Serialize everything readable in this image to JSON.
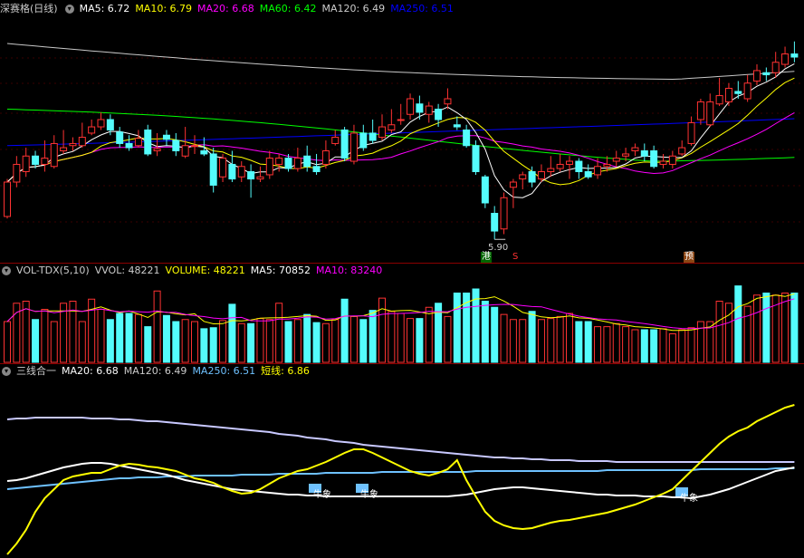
{
  "main_header": {
    "title": "深赛格(日线)",
    "items": [
      {
        "label": "MA5:",
        "value": "6.72",
        "color": "#ffffff"
      },
      {
        "label": "MA10:",
        "value": "6.79",
        "color": "#ffff00"
      },
      {
        "label": "MA20:",
        "value": "6.68",
        "color": "#ff00ff"
      },
      {
        "label": "MA60:",
        "value": "6.42",
        "color": "#00ff00"
      },
      {
        "label": "MA120:",
        "value": "6.49",
        "color": "#cccccc"
      },
      {
        "label": "MA250:",
        "value": "6.51",
        "color": "#0000ff"
      }
    ]
  },
  "vol_header": {
    "items": [
      {
        "label": "VOL-TDX(5,10)",
        "value": "",
        "color": "#cccccc"
      },
      {
        "label": "VVOL:",
        "value": "48221",
        "color": "#cccccc"
      },
      {
        "label": "VOLUME:",
        "value": "48221",
        "color": "#ffff00"
      },
      {
        "label": "MA5:",
        "value": "70852",
        "color": "#ffffff"
      },
      {
        "label": "MA10:",
        "value": "83240",
        "color": "#ff00ff"
      }
    ]
  },
  "ind_header": {
    "items": [
      {
        "label": "三线合一",
        "value": "",
        "color": "#cccccc"
      },
      {
        "label": "MA20:",
        "value": "6.68",
        "color": "#ffffff"
      },
      {
        "label": "MA120:",
        "value": "6.49",
        "color": "#cccccc"
      },
      {
        "label": "MA250:",
        "value": "6.51",
        "color": "#6ec1ff"
      },
      {
        "label": "短线:",
        "value": "6.86",
        "color": "#ffff00"
      }
    ]
  },
  "low_label": "5.90",
  "markers": {
    "gang": "港",
    "s": "S",
    "yu": "预"
  },
  "signal_label": "牛象",
  "colors": {
    "up": "#ff3232",
    "down": "#54fcfc",
    "ma5": "#ffffff",
    "ma10": "#ffff00",
    "ma20": "#ff00ff",
    "ma60": "#00ff00",
    "ma120": "#c8c8c8",
    "ma250": "#0000ff"
  },
  "chart_data": {
    "type": "candlestick",
    "candles": [
      [
        6.12,
        6.45,
        6.48,
        6.1
      ],
      [
        6.45,
        6.62,
        6.7,
        6.4
      ],
      [
        6.55,
        6.7,
        6.78,
        6.5
      ],
      [
        6.7,
        6.62,
        6.75,
        6.58
      ],
      [
        6.62,
        6.68,
        6.85,
        6.55
      ],
      [
        6.6,
        6.82,
        6.9,
        6.58
      ],
      [
        6.75,
        6.78,
        6.95,
        6.72
      ],
      [
        6.8,
        6.82,
        6.88,
        6.75
      ],
      [
        6.8,
        6.88,
        7.02,
        6.78
      ],
      [
        6.92,
        6.98,
        7.05,
        6.9
      ],
      [
        6.98,
        7.05,
        7.12,
        6.95
      ],
      [
        7.05,
        6.95,
        7.1,
        6.9
      ],
      [
        6.93,
        6.82,
        6.98,
        6.78
      ],
      [
        6.82,
        6.78,
        6.9,
        6.75
      ],
      [
        6.8,
        6.87,
        6.95,
        6.78
      ],
      [
        6.95,
        6.72,
        7.0,
        6.7
      ],
      [
        6.75,
        6.77,
        6.92,
        6.7
      ],
      [
        6.9,
        6.86,
        6.95,
        6.8
      ],
      [
        6.85,
        6.75,
        6.92,
        6.7
      ],
      [
        6.7,
        6.8,
        6.98,
        6.68
      ],
      [
        6.8,
        6.8,
        6.9,
        6.72
      ],
      [
        6.75,
        6.72,
        6.88,
        6.7
      ],
      [
        6.72,
        6.42,
        6.78,
        6.35
      ],
      [
        6.5,
        6.68,
        6.72,
        6.45
      ],
      [
        6.62,
        6.48,
        6.75,
        6.45
      ],
      [
        6.5,
        6.6,
        6.65,
        6.45
      ],
      [
        6.55,
        6.48,
        6.62,
        6.3
      ],
      [
        6.48,
        6.5,
        6.6,
        6.45
      ],
      [
        6.52,
        6.68,
        6.75,
        6.48
      ],
      [
        6.62,
        6.68,
        6.72,
        6.55
      ],
      [
        6.68,
        6.58,
        6.72,
        6.55
      ],
      [
        6.58,
        6.68,
        6.78,
        6.55
      ],
      [
        6.7,
        6.6,
        6.8,
        6.55
      ],
      [
        6.6,
        6.55,
        6.72,
        6.52
      ],
      [
        6.62,
        6.75,
        6.85,
        6.58
      ],
      [
        6.82,
        6.88,
        6.95,
        6.8
      ],
      [
        6.95,
        6.68,
        6.98,
        6.65
      ],
      [
        6.65,
        6.92,
        7.0,
        6.62
      ],
      [
        6.92,
        6.78,
        7.0,
        6.75
      ],
      [
        6.92,
        6.85,
        7.05,
        6.82
      ],
      [
        6.88,
        6.98,
        7.1,
        6.85
      ],
      [
        6.95,
        7.0,
        7.15,
        6.92
      ],
      [
        7.05,
        7.05,
        7.2,
        7.0
      ],
      [
        7.1,
        7.25,
        7.3,
        7.05
      ],
      [
        7.2,
        7.12,
        7.28,
        7.05
      ],
      [
        7.1,
        7.18,
        7.22,
        7.02
      ],
      [
        7.15,
        7.05,
        7.2,
        6.98
      ],
      [
        7.2,
        7.25,
        7.35,
        7.15
      ],
      [
        7.0,
        6.98,
        7.08,
        6.95
      ],
      [
        6.95,
        6.8,
        7.0,
        6.78
      ],
      [
        6.8,
        6.55,
        6.85,
        6.52
      ],
      [
        6.5,
        6.25,
        6.52,
        6.2
      ],
      [
        6.15,
        5.98,
        6.22,
        5.9
      ],
      [
        6.0,
        6.3,
        6.35,
        5.95
      ],
      [
        6.4,
        6.45,
        6.48,
        6.2
      ],
      [
        6.48,
        6.52,
        6.55,
        6.38
      ],
      [
        6.55,
        6.45,
        6.6,
        6.4
      ],
      [
        6.48,
        6.55,
        6.62,
        6.45
      ],
      [
        6.55,
        6.58,
        6.7,
        6.5
      ],
      [
        6.58,
        6.62,
        6.72,
        6.55
      ],
      [
        6.62,
        6.65,
        6.7,
        6.48
      ],
      [
        6.65,
        6.55,
        6.68,
        6.48
      ],
      [
        6.55,
        6.5,
        6.62,
        6.48
      ],
      [
        6.52,
        6.6,
        6.68,
        6.48
      ],
      [
        6.6,
        6.62,
        6.7,
        6.55
      ],
      [
        6.65,
        6.68,
        6.75,
        6.6
      ],
      [
        6.7,
        6.72,
        6.78,
        6.65
      ],
      [
        6.75,
        6.78,
        6.82,
        6.7
      ],
      [
        6.75,
        6.7,
        6.82,
        6.65
      ],
      [
        6.75,
        6.6,
        6.8,
        6.58
      ],
      [
        6.62,
        6.65,
        6.72,
        6.58
      ],
      [
        6.62,
        6.7,
        6.75,
        6.58
      ],
      [
        6.72,
        6.78,
        6.85,
        6.7
      ],
      [
        6.82,
        7.02,
        7.08,
        6.8
      ],
      [
        7.05,
        7.22,
        7.25,
        7.0
      ],
      [
        7.0,
        7.22,
        7.3,
        6.98
      ],
      [
        7.2,
        7.28,
        7.45,
        7.18
      ],
      [
        7.22,
        7.35,
        7.4,
        7.18
      ],
      [
        7.32,
        7.3,
        7.42,
        7.25
      ],
      [
        7.25,
        7.4,
        7.48,
        7.22
      ],
      [
        7.42,
        7.52,
        7.58,
        7.38
      ],
      [
        7.5,
        7.48,
        7.55,
        7.42
      ],
      [
        7.5,
        7.6,
        7.7,
        7.45
      ],
      [
        7.58,
        7.68,
        7.75,
        7.55
      ],
      [
        7.68,
        7.65,
        7.8,
        7.6
      ]
    ],
    "volume": [
      40,
      58,
      60,
      42,
      52,
      40,
      58,
      60,
      40,
      62,
      52,
      42,
      48,
      48,
      47,
      35,
      70,
      46,
      40,
      42,
      40,
      33,
      34,
      41,
      57,
      38,
      38,
      43,
      42,
      58,
      40,
      42,
      47,
      39,
      38,
      42,
      62,
      45,
      42,
      51,
      63,
      50,
      48,
      43,
      43,
      54,
      58,
      45,
      68,
      68,
      72,
      60,
      54,
      47,
      42,
      42,
      50,
      42,
      43,
      45,
      48,
      40,
      40,
      35,
      35,
      38,
      35,
      32,
      32,
      32,
      33,
      28,
      32,
      34,
      40,
      40,
      60,
      58,
      75,
      55,
      66,
      68,
      66,
      68,
      68
    ],
    "ind_series": {
      "ma20": [
        531,
        530,
        528,
        525,
        522,
        519,
        516,
        514,
        512,
        511,
        511,
        512,
        514,
        516,
        518,
        520,
        522,
        524,
        527,
        530,
        532,
        534,
        536,
        538,
        540,
        541,
        542,
        543,
        544,
        545,
        546,
        546,
        547,
        547,
        548,
        548,
        548,
        548,
        548,
        548,
        548,
        548,
        548,
        548,
        548,
        548,
        548,
        548,
        547,
        546,
        544,
        542,
        540,
        539,
        538,
        538,
        539,
        540,
        541,
        542,
        543,
        544,
        545,
        546,
        546,
        547,
        547,
        547,
        548,
        548,
        548,
        549,
        549,
        550,
        548,
        546,
        543,
        540,
        536,
        532,
        528,
        524,
        520,
        518,
        516
      ],
      "ma120": [
        463,
        462,
        462,
        461,
        461,
        461,
        461,
        461,
        461,
        462,
        462,
        462,
        463,
        463,
        464,
        465,
        465,
        466,
        467,
        468,
        469,
        470,
        471,
        472,
        473,
        474,
        475,
        476,
        477,
        479,
        480,
        481,
        483,
        484,
        485,
        487,
        488,
        489,
        491,
        492,
        493,
        494,
        495,
        496,
        497,
        498,
        499,
        500,
        501,
        502,
        503,
        504,
        505,
        505,
        506,
        506,
        507,
        507,
        508,
        508,
        508,
        509,
        509,
        509,
        509,
        510,
        510,
        510,
        510,
        510,
        510,
        510,
        510,
        510,
        510,
        510,
        510,
        510,
        510,
        510,
        510,
        510,
        510,
        510,
        510
      ],
      "ma250": [
        540,
        539,
        538,
        537,
        536,
        535,
        534,
        533,
        532,
        531,
        530,
        529,
        528,
        528,
        527,
        527,
        527,
        526,
        526,
        526,
        525,
        525,
        525,
        525,
        525,
        524,
        524,
        524,
        524,
        523,
        523,
        523,
        523,
        523,
        522,
        522,
        522,
        522,
        522,
        522,
        521,
        521,
        521,
        521,
        521,
        521,
        521,
        521,
        521,
        521,
        520,
        520,
        520,
        520,
        520,
        520,
        520,
        520,
        520,
        520,
        520,
        520,
        520,
        520,
        519,
        519,
        519,
        519,
        519,
        519,
        519,
        519,
        519,
        519,
        518,
        518,
        518,
        518,
        518,
        518,
        518,
        518,
        517,
        517,
        517
      ],
      "short": [
        612,
        600,
        585,
        565,
        550,
        540,
        530,
        526,
        524,
        522,
        522,
        518,
        514,
        512,
        513,
        515,
        516,
        518,
        520,
        524,
        528,
        530,
        533,
        538,
        542,
        545,
        544,
        540,
        534,
        528,
        524,
        520,
        518,
        514,
        510,
        505,
        500,
        496,
        496,
        500,
        505,
        510,
        515,
        520,
        523,
        525,
        522,
        518,
        508,
        530,
        548,
        565,
        575,
        580,
        583,
        584,
        583,
        580,
        577,
        575,
        574,
        572,
        570,
        568,
        566,
        563,
        560,
        557,
        553,
        549,
        545,
        540,
        530,
        520,
        510,
        500,
        490,
        482,
        476,
        472,
        465,
        460,
        455,
        450,
        447
      ]
    },
    "signals_at": [
      22,
      27,
      51
    ]
  }
}
